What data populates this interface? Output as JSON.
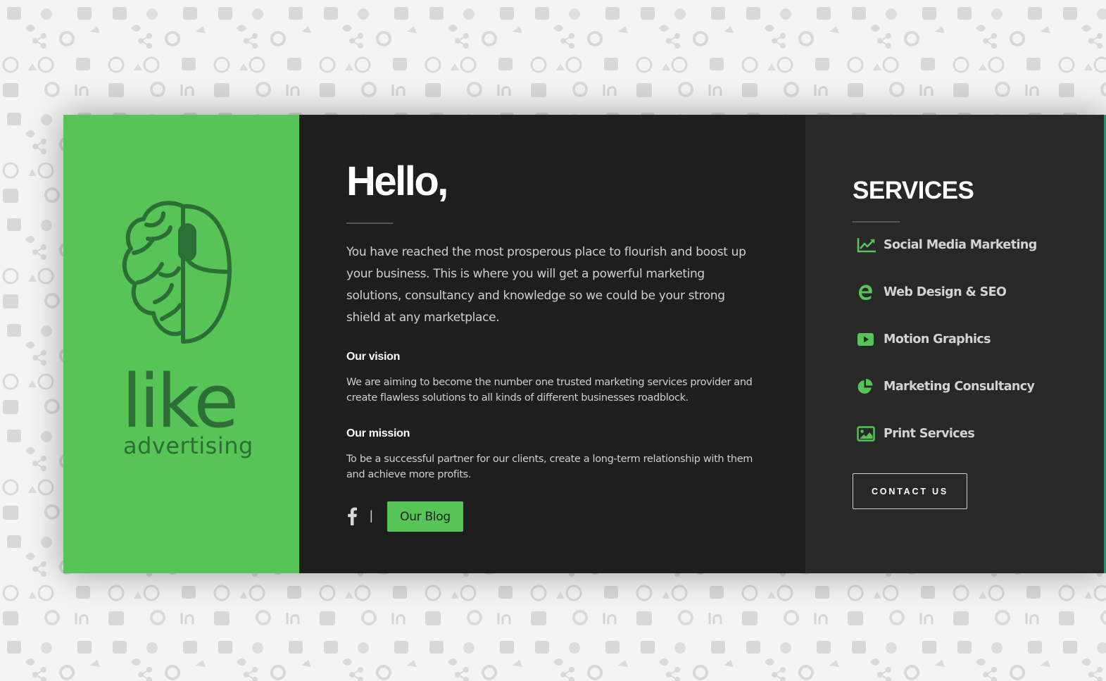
{
  "brand": {
    "name": "like",
    "tagline": "advertising",
    "color": "#56c456",
    "logo_color": "#2c6e36"
  },
  "main": {
    "greeting": "Hello,",
    "intro": "You have reached the most prosperous place to flourish and boost up your business. This is where you will get a powerful marketing solutions, consultancy and knowledge so we could be your strong shield at any marketplace.",
    "vision": {
      "heading": "Our vision",
      "text": "We are aiming to become the number one trusted marketing services provider and create flawless solutions to all kinds of different businesses roadblock."
    },
    "mission": {
      "heading": "Our mission",
      "text": "To be a successful partner for our clients, create a long-term relationship with them and achieve more profits."
    },
    "social_icon": "facebook-icon",
    "divider": "|",
    "blog_button": "Our Blog"
  },
  "services": {
    "title": "SERVICES",
    "items": [
      {
        "label": "Social Media Marketing",
        "icon": "line-chart-icon"
      },
      {
        "label": "Web Design & SEO",
        "icon": "edge-icon"
      },
      {
        "label": "Motion Graphics",
        "icon": "video-play-icon"
      },
      {
        "label": "Marketing Consultancy",
        "icon": "pie-chart-icon"
      },
      {
        "label": "Print Services",
        "icon": "image-icon"
      }
    ],
    "contact_button": "CONTACT US"
  },
  "colors": {
    "accent": "#56c456",
    "dark_panel": "#1e1e1e",
    "services_panel": "#282828",
    "page_background": "#f4f4f4"
  }
}
